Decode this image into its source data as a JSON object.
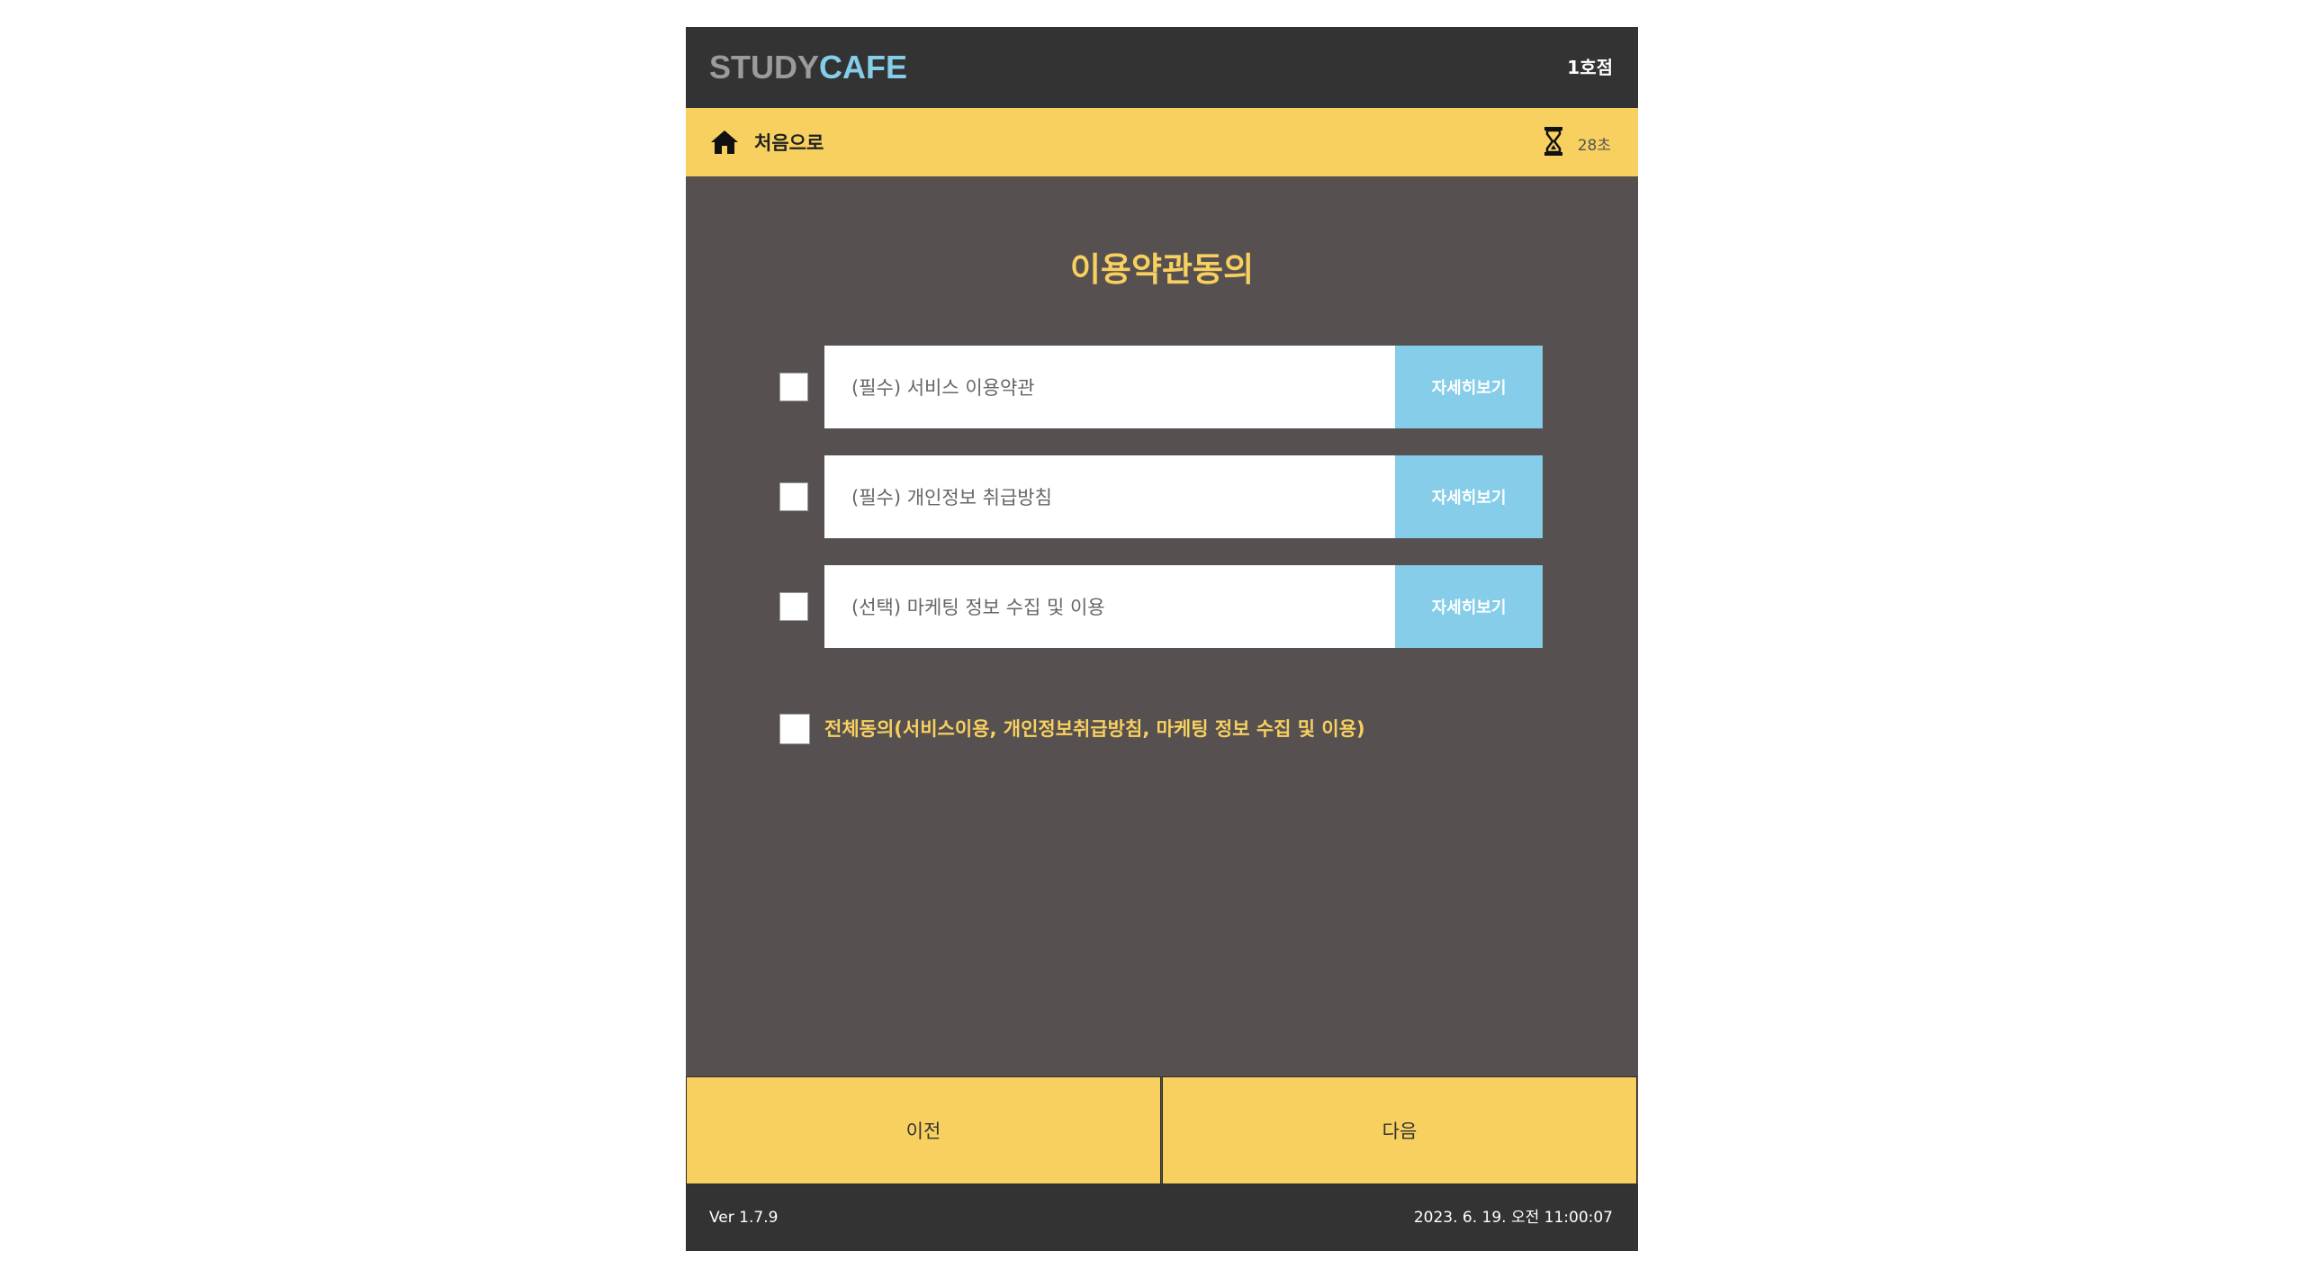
{
  "header": {
    "logo_part1": "STUDY",
    "logo_part2": "CAFE",
    "branch": "1호점"
  },
  "subbar": {
    "home_label": "처음으로",
    "timer_text": "28초",
    "home_icon": "home-icon",
    "timer_icon": "hourglass-icon"
  },
  "main": {
    "title": "이용약관동의",
    "terms": [
      {
        "label": "(필수) 서비스 이용약관",
        "detail_label": "자세히보기"
      },
      {
        "label": "(필수) 개인정보 취급방침",
        "detail_label": "자세히보기"
      },
      {
        "label": "(선택) 마케팅 정보 수집 및 이용",
        "detail_label": "자세히보기"
      }
    ],
    "agree_all_label": "전체동의(서비스이용, 개인정보취급방침, 마케팅 정보 수집 및 이용)"
  },
  "nav": {
    "prev_label": "이전",
    "next_label": "다음"
  },
  "footer": {
    "version": "Ver 1.7.9",
    "datetime": "2023. 6. 19. 오전 11:00:07"
  },
  "colors": {
    "accent_yellow": "#f7d05f",
    "accent_blue": "#86cde9",
    "panel_bg": "#575051",
    "bar_dark": "#333333"
  }
}
